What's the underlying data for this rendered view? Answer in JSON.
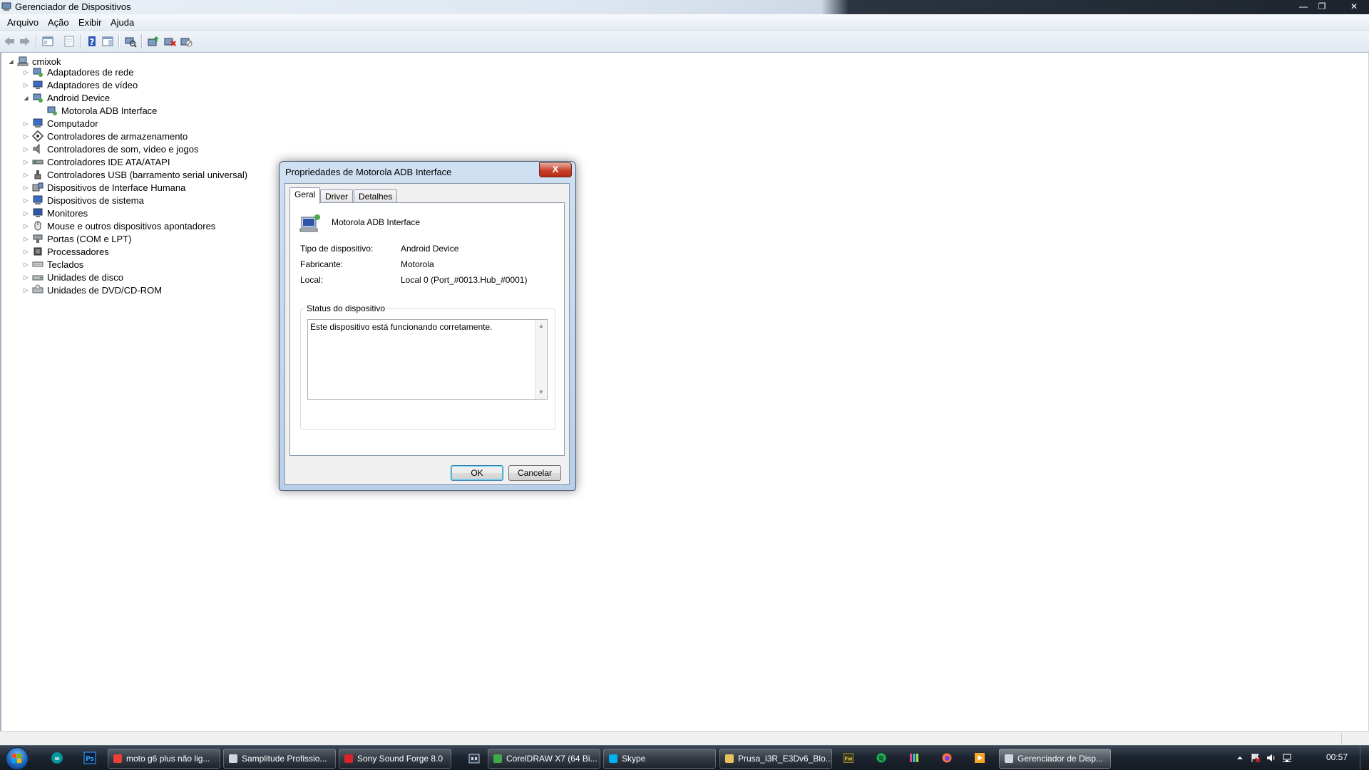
{
  "window": {
    "title": "Gerenciador de Dispositivos",
    "controls": [
      "—",
      "❐",
      "✕"
    ]
  },
  "menu": [
    "Arquivo",
    "Ação",
    "Exibir",
    "Ajuda"
  ],
  "toolbar": {
    "icons": [
      "back-arrow-icon",
      "forward-arrow-icon",
      "console-tree-icon",
      "properties-sheet-icon",
      "help-icon",
      "action-pane-icon",
      "scan-hardware-icon",
      "update-driver-icon",
      "uninstall-device-icon",
      "disable-device-icon"
    ]
  },
  "tree": {
    "root": "cmixok",
    "items": [
      {
        "label": "Adaptadores de rede",
        "icon": "network-adapter-icon",
        "expanded": false
      },
      {
        "label": "Adaptadores de vídeo",
        "icon": "display-adapter-icon",
        "expanded": false
      },
      {
        "label": "Android Device",
        "icon": "android-device-icon",
        "expanded": true
      },
      {
        "label": "Motorola ADB Interface",
        "icon": "adb-interface-icon",
        "child": true
      },
      {
        "label": "Computador",
        "icon": "computer-icon",
        "expanded": false
      },
      {
        "label": "Controladores de armazenamento",
        "icon": "storage-controller-icon",
        "expanded": false
      },
      {
        "label": "Controladores de som, vídeo e jogos",
        "icon": "sound-icon",
        "expanded": false
      },
      {
        "label": "Controladores IDE ATA/ATAPI",
        "icon": "ide-controller-icon",
        "expanded": false
      },
      {
        "label": "Controladores USB (barramento serial universal)",
        "icon": "usb-icon",
        "expanded": false
      },
      {
        "label": "Dispositivos de Interface Humana",
        "icon": "hid-icon",
        "expanded": false
      },
      {
        "label": "Dispositivos de sistema",
        "icon": "system-device-icon",
        "expanded": false
      },
      {
        "label": "Monitores",
        "icon": "monitor-icon",
        "expanded": false
      },
      {
        "label": "Mouse e outros dispositivos apontadores",
        "icon": "mouse-icon",
        "expanded": false
      },
      {
        "label": "Portas (COM e LPT)",
        "icon": "port-icon",
        "expanded": false
      },
      {
        "label": "Processadores",
        "icon": "processor-icon",
        "expanded": false
      },
      {
        "label": "Teclados",
        "icon": "keyboard-icon",
        "expanded": false
      },
      {
        "label": "Unidades de disco",
        "icon": "disk-drive-icon",
        "expanded": false
      },
      {
        "label": "Unidades de DVD/CD-ROM",
        "icon": "dvd-drive-icon",
        "expanded": false
      }
    ]
  },
  "dialog": {
    "title": "Propriedades de Motorola ADB Interface",
    "close": "X",
    "tabs": [
      "Geral",
      "Driver",
      "Detalhes"
    ],
    "device_name": "Motorola ADB Interface",
    "properties": [
      {
        "label": "Tipo de dispositivo:",
        "value": "Android Device"
      },
      {
        "label": "Fabricante:",
        "value": "Motorola"
      },
      {
        "label": "Local:",
        "value": "Local 0 (Port_#0013.Hub_#0001)"
      }
    ],
    "status_group": "Status do dispositivo",
    "status_text": "Este dispositivo está funcionando corretamente.",
    "ok": "OK",
    "cancel": "Cancelar"
  },
  "taskbar": {
    "pinned": [
      "arduino-icon",
      "photoshop-icon"
    ],
    "tasks": [
      {
        "label": "moto g6 plus não lig...",
        "icon": "chrome-icon",
        "color": "#e94235"
      },
      {
        "label": "Samplitude Profissio...",
        "icon": "samplitude-icon",
        "color": "#cfd6df"
      },
      {
        "label": "Sony Sound Forge 8.0",
        "icon": "sound-forge-icon",
        "color": "#d8232a"
      },
      {
        "label": "CorelDRAW X7 (64 Bi...",
        "icon": "coreldraw-icon",
        "color": "#3daa49"
      },
      {
        "label": "Skype",
        "icon": "skype-icon",
        "color": "#00aff0"
      },
      {
        "label": "Prusa_i3R_E3Dv6_Blo...",
        "icon": "folder-icon",
        "color": "#e8c15a"
      },
      {
        "label": "Gerenciador de Disp...",
        "icon": "device-manager-icon",
        "color": "#cfd6df"
      }
    ],
    "tray_icons": [
      "fireworks-icon",
      "spotify-icon",
      "app-icon",
      "firefox-icon",
      "media-icon"
    ],
    "clock": "00:57"
  }
}
